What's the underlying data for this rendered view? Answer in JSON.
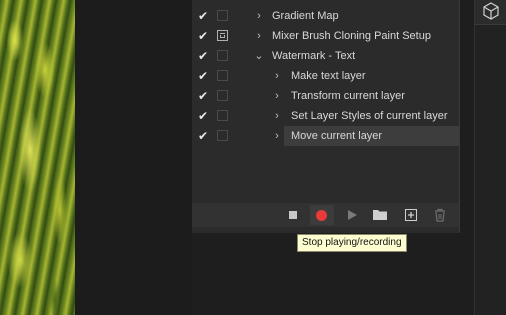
{
  "actions_panel": {
    "rows": [
      {
        "label": "Gradient Map",
        "checked": true,
        "dialog": false,
        "chevron": "›",
        "indent": 1
      },
      {
        "label": "Mixer Brush Cloning Paint Setup",
        "checked": true,
        "dialog": true,
        "chevron": "›",
        "indent": 1
      },
      {
        "label": "Watermark - Text",
        "checked": true,
        "dialog": false,
        "chevron": "⌄",
        "indent": 1
      },
      {
        "label": "Make text layer",
        "checked": true,
        "dialog": false,
        "chevron": "›",
        "indent": 2
      },
      {
        "label": "Transform current layer",
        "checked": true,
        "dialog": false,
        "chevron": "›",
        "indent": 2
      },
      {
        "label": "Set Layer Styles of current layer",
        "checked": true,
        "dialog": false,
        "chevron": "›",
        "indent": 2
      },
      {
        "label": "Move current layer",
        "checked": true,
        "dialog": false,
        "chevron": "›",
        "indent": 2,
        "selected": true
      }
    ],
    "toolbar": {
      "stop_icon": "stop-icon",
      "record_icon": "record-icon",
      "play_icon": "play-icon",
      "folder_icon": "folder-icon",
      "new_action_icon": "new-action-icon",
      "delete_icon": "trash-icon",
      "record_color": "#e83a3a"
    }
  },
  "tooltip": {
    "text": "Stop playing/recording"
  },
  "colors": {
    "panel_bg": "#2b2b2b",
    "selected_row": "#3d3d3d",
    "tooltip_bg": "#fffed0"
  }
}
